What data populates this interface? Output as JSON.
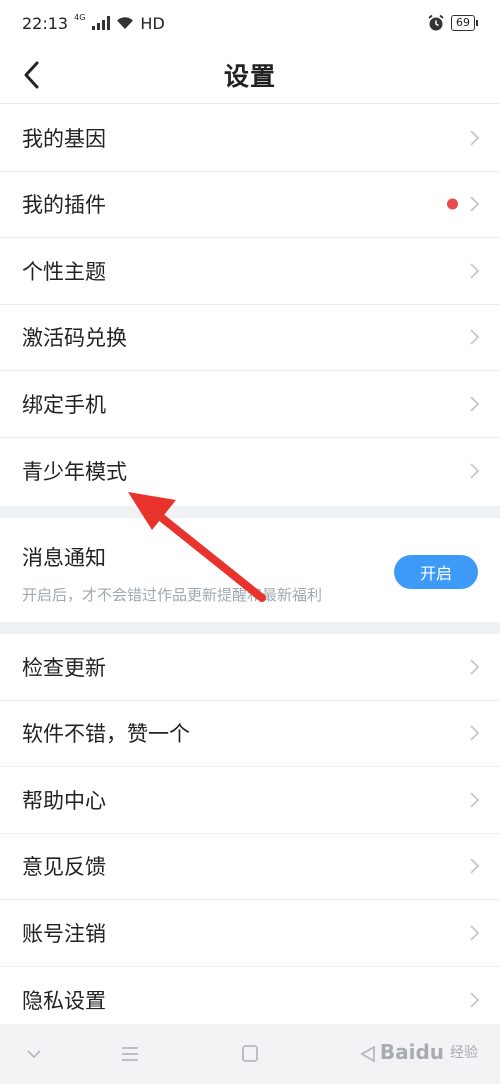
{
  "status_bar": {
    "time": "22:13",
    "network": "4G",
    "hd": "HD",
    "battery": "69"
  },
  "header": {
    "title": "设置"
  },
  "group1": [
    {
      "label": "我的基因",
      "dot": false
    },
    {
      "label": "我的插件",
      "dot": true
    },
    {
      "label": "个性主题",
      "dot": false
    },
    {
      "label": "激活码兑换",
      "dot": false
    },
    {
      "label": "绑定手机",
      "dot": false
    },
    {
      "label": "青少年模式",
      "dot": false
    }
  ],
  "notification": {
    "title": "消息通知",
    "desc": "开启后，才不会错过作品更新提醒和最新福利",
    "button": "开启"
  },
  "group2": [
    {
      "label": "检查更新"
    },
    {
      "label": "软件不错，赞一个"
    },
    {
      "label": "帮助中心"
    },
    {
      "label": "意见反馈"
    },
    {
      "label": "账号注销"
    },
    {
      "label": "隐私设置"
    }
  ],
  "watermark": {
    "brand": "Baidu",
    "sub": "经验"
  },
  "colors": {
    "accent": "#3d9af6",
    "red_dot": "#e84a4d",
    "annotation_arrow": "#e8332c",
    "separator": "#eff1f4"
  }
}
